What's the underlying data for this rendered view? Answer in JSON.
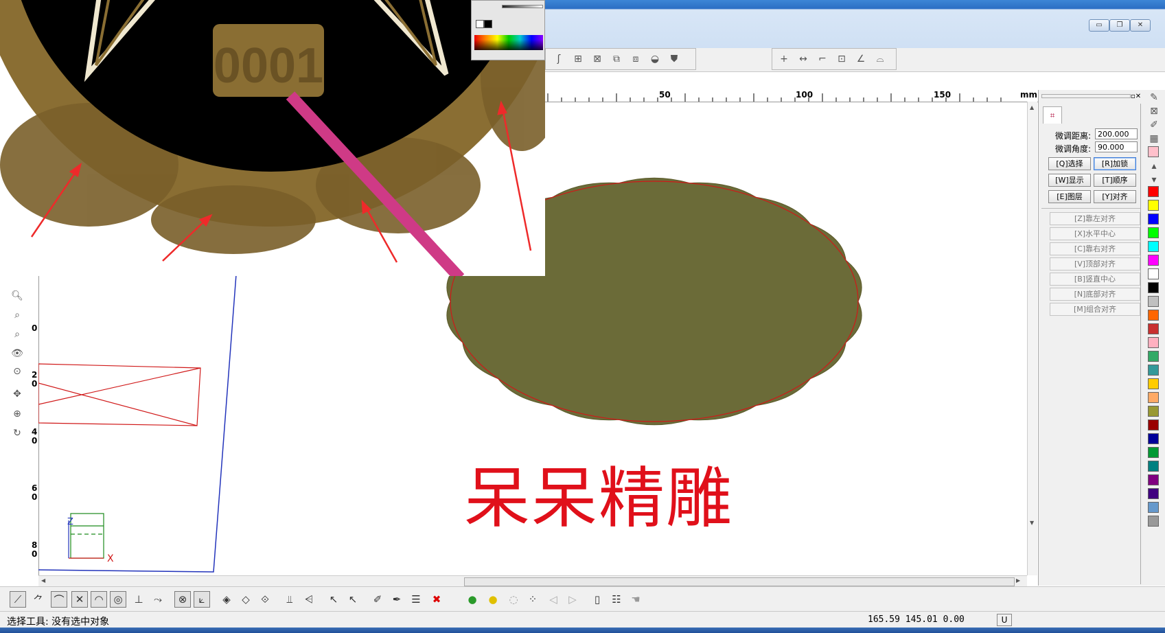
{
  "window": {
    "minimize_label": "▭",
    "restore_label": "❐",
    "close_label": "✕"
  },
  "ruler": {
    "unit": "mm",
    "top_labels": [
      "50",
      "100",
      "150"
    ],
    "left_labels": [
      "0",
      "2\n0",
      "4\n0",
      "6\n0",
      "8\n0"
    ]
  },
  "panel": {
    "fine_distance_label": "微调距离:",
    "fine_distance_value": "200.000",
    "fine_angle_label": "微调角度:",
    "fine_angle_value": "90.000",
    "buttons": [
      {
        "label": "[Q]选择",
        "active": false
      },
      {
        "label": "[R]加锁",
        "active": true
      },
      {
        "label": "[W]显示",
        "active": false
      },
      {
        "label": "[T]顺序",
        "active": false
      },
      {
        "label": "[E]图层",
        "active": false
      },
      {
        "label": "[Y]对齐",
        "active": false
      }
    ],
    "align_buttons": [
      "[Z]靠左对齐",
      "[X]水平中心",
      "[C]靠右对齐",
      "[V]顶部对齐",
      "[B]竖直中心",
      "[N]底部对齐",
      "[M]组合对齐"
    ]
  },
  "palette": {
    "colors": [
      "#ff0000",
      "#ffff00",
      "#0000ff",
      "#00ff00",
      "#00ffff",
      "#ff00ff",
      "#ffffff",
      "#000000",
      "#c0c0c0",
      "#ff6600",
      "#c83030",
      "#ffb0c0",
      "#33aa66",
      "#339999",
      "#ffcc00",
      "#ffaa66",
      "#999933",
      "#990000",
      "#000099",
      "#009933",
      "#008080",
      "#800080",
      "#400080",
      "#6699cc",
      "#999999"
    ]
  },
  "canvas": {
    "caption": "呆呆精雕",
    "axis_z": "Z",
    "axis_x": "X"
  },
  "overlay": {
    "badge_text": "0001"
  },
  "status": {
    "message": "选择工具: 没有选中对象",
    "coordinates": "165.59 145.01 0.00",
    "mode": "U"
  },
  "colors": {
    "bronze": "#8a6e33",
    "olive": "#6b6b38",
    "arrow": "#ee2a2a",
    "pink_stroke": "#cf3a86"
  }
}
